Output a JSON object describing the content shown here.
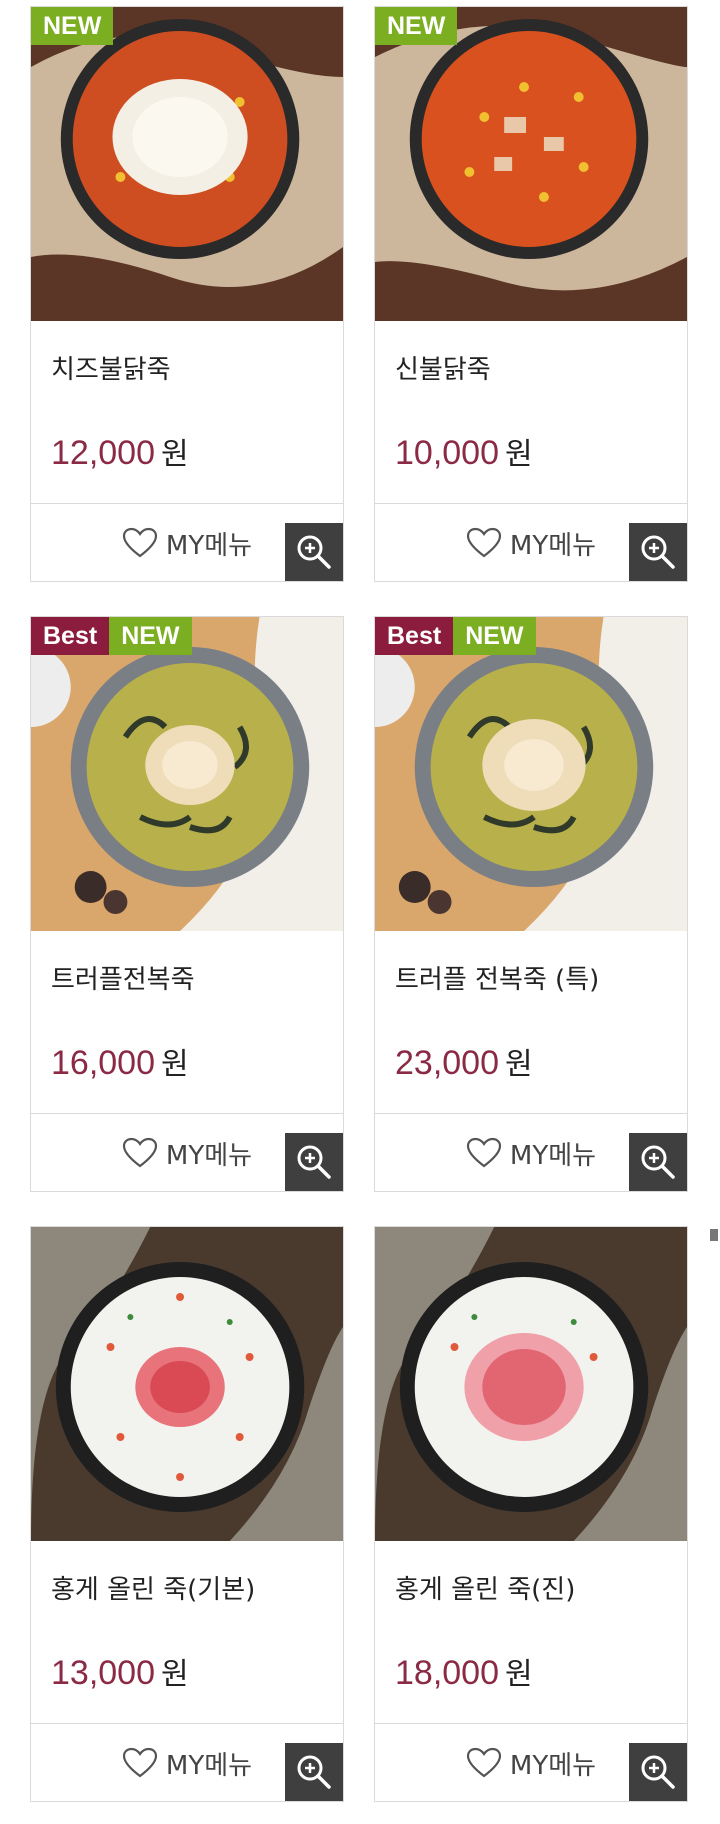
{
  "products": [
    {
      "name": "치즈불닭죽",
      "price": "12,000",
      "currency": "원",
      "badges": [
        "NEW"
      ],
      "favorite_label": "MY메뉴",
      "zoom_icon": "zoom-in-icon",
      "favorite_icon": "heart-outline-icon",
      "image": "red-porridge-with-cheese"
    },
    {
      "name": "신불닭죽",
      "price": "10,000",
      "currency": "원",
      "badges": [
        "NEW"
      ],
      "favorite_label": "MY메뉴",
      "zoom_icon": "zoom-in-icon",
      "favorite_icon": "heart-outline-icon",
      "image": "red-porridge"
    },
    {
      "name": "트러플전복죽",
      "price": "16,000",
      "currency": "원",
      "badges": [
        "Best",
        "NEW"
      ],
      "favorite_label": "MY메뉴",
      "zoom_icon": "zoom-in-icon",
      "favorite_icon": "heart-outline-icon",
      "image": "truffle-abalone-porridge"
    },
    {
      "name": "트러플 전복죽 (특)",
      "price": "23,000",
      "currency": "원",
      "badges": [
        "Best",
        "NEW"
      ],
      "favorite_label": "MY메뉴",
      "zoom_icon": "zoom-in-icon",
      "favorite_icon": "heart-outline-icon",
      "image": "truffle-abalone-porridge"
    },
    {
      "name": "홍게 올린 죽(기본)",
      "price": "13,000",
      "currency": "원",
      "badges": [],
      "favorite_label": "MY메뉴",
      "zoom_icon": "zoom-in-icon",
      "favorite_icon": "heart-outline-icon",
      "image": "red-crab-porridge"
    },
    {
      "name": "홍게 올린 죽(진)",
      "price": "18,000",
      "currency": "원",
      "badges": [],
      "favorite_label": "MY메뉴",
      "zoom_icon": "zoom-in-icon",
      "favorite_icon": "heart-outline-icon",
      "image": "red-crab-porridge"
    }
  ],
  "colors": {
    "new_badge": "#7cae21",
    "best_badge": "#8c1c3e",
    "price": "#8a2a45",
    "zoom_bg": "#3f3f3f"
  }
}
